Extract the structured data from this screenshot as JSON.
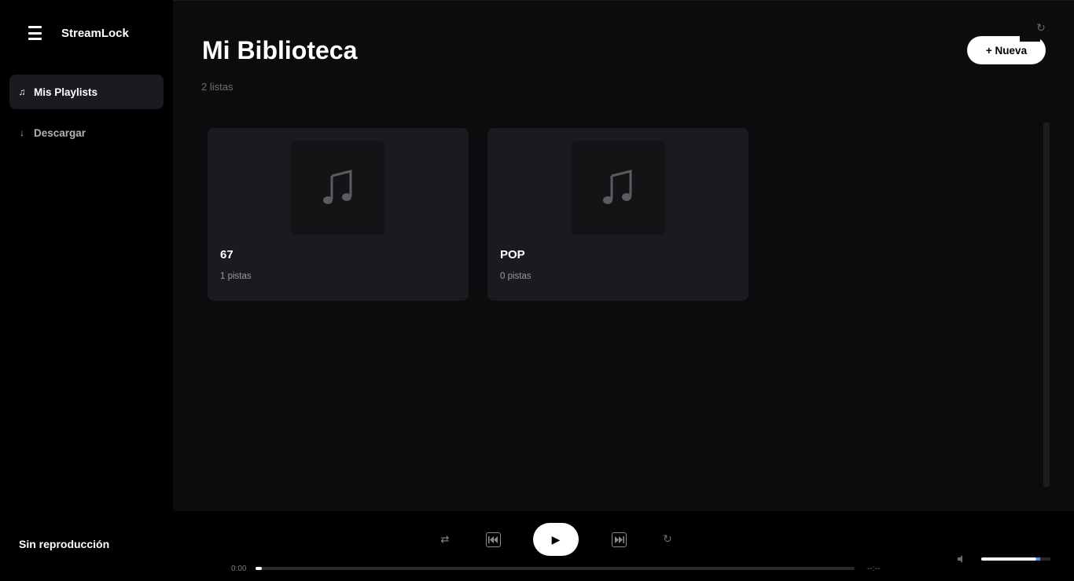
{
  "sidebar": {
    "brand": "StreamLock",
    "items": [
      {
        "label": "Mis Playlists",
        "icon": "music-note-icon",
        "active": true
      },
      {
        "label": "Descargar",
        "icon": "download-arrow-icon",
        "active": false
      }
    ]
  },
  "main": {
    "title": "Mi Biblioteca",
    "subtitle": "2 listas",
    "new_button": "+ Nueva",
    "playlists": [
      {
        "name": "67",
        "count": "1 pistas"
      },
      {
        "name": "POP",
        "count": "0 pistas"
      }
    ]
  },
  "player": {
    "now_playing": "Sin reproducción",
    "current_time": "0:00",
    "total_time": "--:--",
    "progress": 0.01,
    "volume": 0.85,
    "play_icon": "▶",
    "shuffle_icon": "⇄",
    "repeat_icon": "↻"
  },
  "colors": {
    "background": "#0c0c0e",
    "sidebar": "#000000",
    "card": "#1b1b1f",
    "accent_volume": "#5a8fd8"
  }
}
